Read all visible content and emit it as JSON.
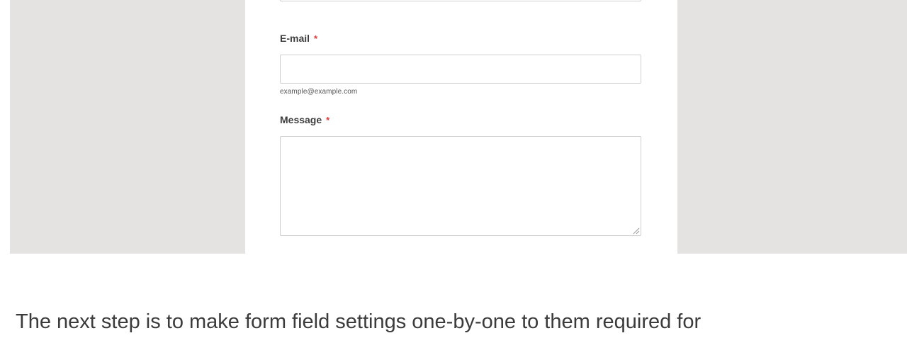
{
  "form": {
    "email": {
      "label": "E-mail",
      "required_mark": "*",
      "value": "",
      "sublabel": "example@example.com"
    },
    "message": {
      "label": "Message",
      "required_mark": "*",
      "value": ""
    }
  },
  "caption": {
    "text": "The next step is to make form field settings one-by-one to them required for"
  },
  "colors": {
    "frame_background": "#e4e3e1",
    "required_mark": "#e2383a",
    "label_text": "#3e3e3e",
    "field_border": "#cfcfcf"
  },
  "icons": {
    "resize_handle": "resize-handle-icon"
  }
}
